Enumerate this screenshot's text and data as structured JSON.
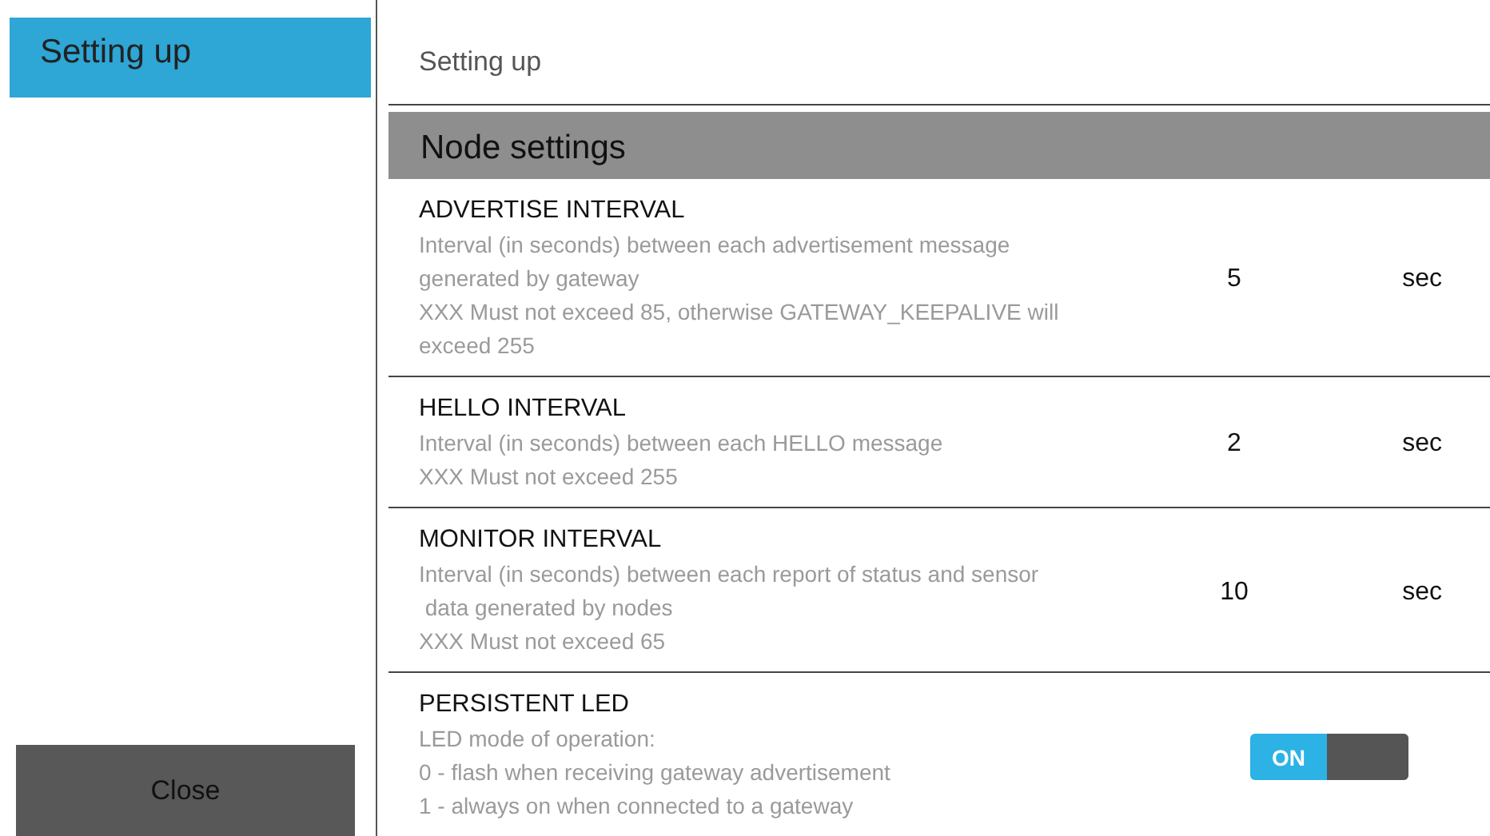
{
  "sidebar": {
    "items": [
      {
        "label": "Setting up",
        "selected": true
      }
    ],
    "close_button": "Close"
  },
  "breadcrumb": "Setting up",
  "section": {
    "title": "Node settings"
  },
  "settings": [
    {
      "kind": "number",
      "title": "ADVERTISE INTERVAL",
      "description": [
        "Interval (in seconds) between each advertisement message",
        "generated by gateway",
        "XXX Must not exceed 85, otherwise GATEWAY_KEEPALIVE will",
        "exceed 255"
      ],
      "value": "5",
      "unit": "sec"
    },
    {
      "kind": "number",
      "title": "HELLO INTERVAL",
      "description": [
        "Interval (in seconds) between each HELLO message",
        "XXX Must not exceed 255"
      ],
      "value": "2",
      "unit": "sec"
    },
    {
      "kind": "number",
      "title": "MONITOR INTERVAL",
      "description": [
        "Interval (in seconds) between each report of status and sensor",
        " data generated by nodes",
        "XXX Must not exceed 65"
      ],
      "value": "10",
      "unit": "sec"
    },
    {
      "kind": "toggle",
      "title": "PERSISTENT LED",
      "description": [
        "LED mode of operation:",
        "0 - flash when receiving gateway advertisement",
        "1 - always on when connected to a gateway"
      ],
      "on": true,
      "label": "ON"
    }
  ]
}
